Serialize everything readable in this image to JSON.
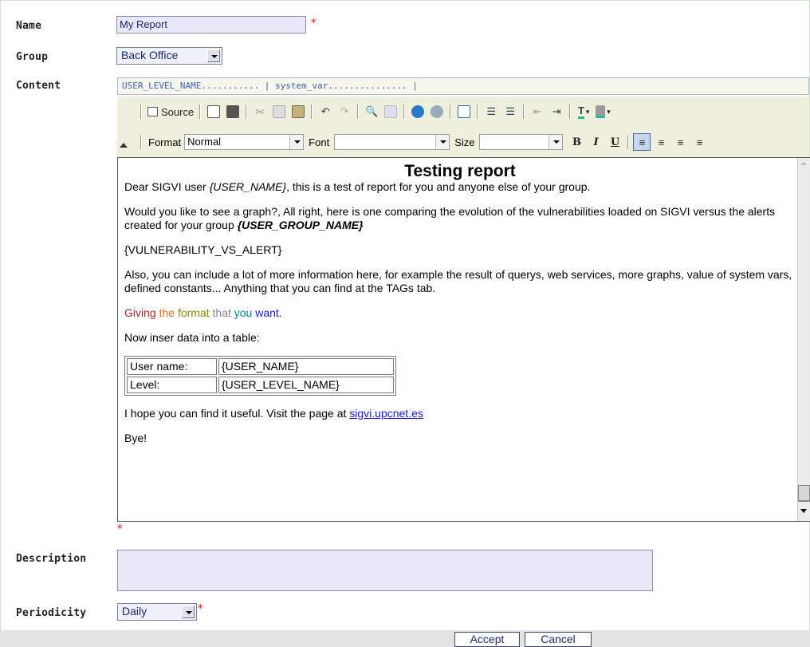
{
  "form": {
    "name_label": "Name",
    "name_value": "My Report",
    "group_label": "Group",
    "group_value": "Back Office",
    "content_label": "Content",
    "description_label": "Description",
    "description_value": "",
    "periodicity_label": "Periodicity",
    "periodicity_value": "Daily",
    "required_mark": "*"
  },
  "tagbar": {
    "text": "USER_LEVEL_NAME........... | system_var............... |"
  },
  "toolbar": {
    "source_label": "Source",
    "format_label": "Format",
    "format_value": "Normal",
    "font_label": "Font",
    "font_value": "",
    "size_label": "Size",
    "size_value": "",
    "bold": "B",
    "italic": "I",
    "underline": "U"
  },
  "editor": {
    "title": "Testing report",
    "p1_a": "Dear SIGVI user ",
    "p1_var": "{USER_NAME}",
    "p1_b": ", this is a test of report for you and anyone else of your group.",
    "p2_a": "Would you like to see a graph?, All right, here is one comparing the evolution of the vulnerabilities loaded on SIGVI versus the alerts created for your group ",
    "p2_var": "{USER_GROUP_NAME}",
    "p3": "{VULNERABILITY_VS_ALERT}",
    "p4": "Also, you can include a lot of more information here, for example the result of querys, web services, more graphs, value of system vars, defined constants...  Anything that you can find at the TAGs tab.",
    "p5_w1": "Giving",
    "p5_w2": "the",
    "p5_w3": "format",
    "p5_w4": "that",
    "p5_w5": "you",
    "p5_w6": "want.",
    "p6": "Now inser data into a table:",
    "table": [
      {
        "k": "User name:",
        "v": "{USER_NAME}"
      },
      {
        "k": "Level:",
        "v": "{USER_LEVEL_NAME}"
      }
    ],
    "p7_a": "I hope you can find it useful. Visit the page at ",
    "p7_link": "sigvi.upcnet.es",
    "p8": "Bye!"
  },
  "buttons": {
    "accept": "Accept",
    "cancel": "Cancel"
  },
  "colors": {
    "giving": "#b22222",
    "the": "#e07020",
    "format": "#8a8a00",
    "that": "#888888",
    "you": "#008b8b",
    "want": "#1a1ae0",
    "link": "#1a1ae0",
    "required": "#e00000"
  }
}
